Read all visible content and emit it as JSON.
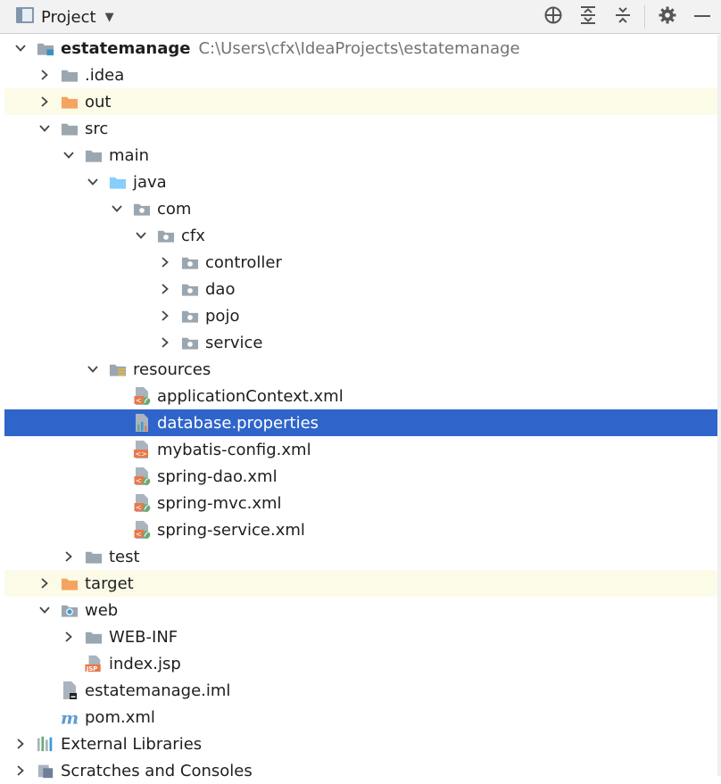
{
  "toolbar": {
    "title": "Project",
    "icons": [
      "project-view-icon",
      "chevron-down-icon",
      "locate-icon",
      "expand-all-icon",
      "collapse-all-icon",
      "gear-icon",
      "minimize-icon"
    ]
  },
  "colors": {
    "selection": "#2f65ca",
    "highlight": "#fcfbe8",
    "folder_gray": "#9aa7b0",
    "folder_orange": "#f4a460",
    "folder_blue": "#87cefa",
    "spring_green": "#6aab73",
    "xml_orange": "#e8794a"
  },
  "tree": {
    "rows": [
      {
        "label": "estatemanage",
        "path": "C:\\Users\\cfx\\IdeaProjects\\estatemanage",
        "icon": "module-folder-icon"
      },
      {
        "label": ".idea",
        "icon": "folder-icon"
      },
      {
        "label": "out",
        "icon": "excluded-folder-icon"
      },
      {
        "label": "src",
        "icon": "folder-icon"
      },
      {
        "label": "main",
        "icon": "folder-icon"
      },
      {
        "label": "java",
        "icon": "source-folder-icon"
      },
      {
        "label": "com",
        "icon": "package-icon"
      },
      {
        "label": "cfx",
        "icon": "package-icon"
      },
      {
        "label": "controller",
        "icon": "package-icon"
      },
      {
        "label": "dao",
        "icon": "package-icon"
      },
      {
        "label": "pojo",
        "icon": "package-icon"
      },
      {
        "label": "service",
        "icon": "package-icon"
      },
      {
        "label": "resources",
        "icon": "resources-folder-icon"
      },
      {
        "label": "applicationContext.xml",
        "icon": "spring-xml-icon"
      },
      {
        "label": "database.properties",
        "icon": "properties-file-icon"
      },
      {
        "label": "mybatis-config.xml",
        "icon": "xml-file-icon"
      },
      {
        "label": "spring-dao.xml",
        "icon": "spring-xml-icon"
      },
      {
        "label": "spring-mvc.xml",
        "icon": "spring-xml-icon"
      },
      {
        "label": "spring-service.xml",
        "icon": "spring-xml-icon"
      },
      {
        "label": "test",
        "icon": "folder-icon"
      },
      {
        "label": "target",
        "icon": "excluded-folder-icon"
      },
      {
        "label": "web",
        "icon": "web-folder-icon"
      },
      {
        "label": "WEB-INF",
        "icon": "folder-icon"
      },
      {
        "label": "index.jsp",
        "icon": "jsp-file-icon"
      },
      {
        "label": "estatemanage.iml",
        "icon": "iml-file-icon"
      },
      {
        "label": "pom.xml",
        "icon": "maven-icon"
      },
      {
        "label": "External Libraries",
        "icon": "libraries-icon"
      },
      {
        "label": "Scratches and Consoles",
        "icon": "scratches-icon"
      }
    ]
  }
}
